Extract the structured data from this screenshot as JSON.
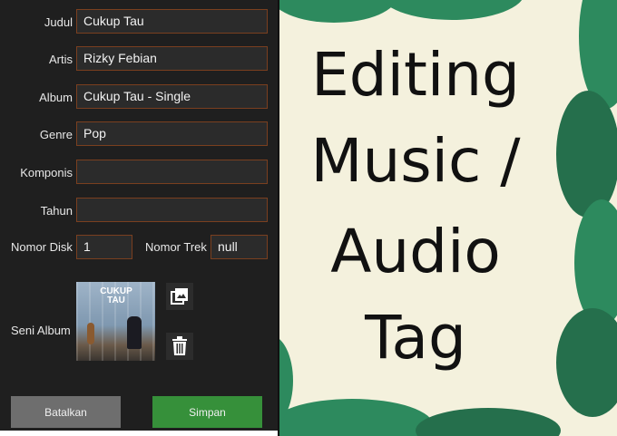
{
  "form": {
    "fields": [
      {
        "label": "Judul",
        "value": "Cukup Tau"
      },
      {
        "label": "Artis",
        "value": "Rizky Febian"
      },
      {
        "label": "Album",
        "value": "Cukup Tau - Single"
      },
      {
        "label": "Genre",
        "value": "Pop"
      },
      {
        "label": "Komponis",
        "value": ""
      },
      {
        "label": "Tahun",
        "value": ""
      }
    ],
    "disk": {
      "label": "Nomor Disk",
      "value": "1"
    },
    "track": {
      "label": "Nomor Trek",
      "value": "null"
    },
    "album_art": {
      "label": "Seni Album",
      "cover_text": "CUKUP TAU"
    },
    "cancel_label": "Batalkan",
    "save_label": "Simpan"
  },
  "banner": {
    "lines": [
      "Editing",
      "Music /",
      "Audio",
      "Tag"
    ]
  },
  "colors": {
    "panel": "#1f1f1f",
    "field_border": "#7a3f1f",
    "save": "#36903a",
    "cancel": "#6e6e6e",
    "leaf": "#2d8a5e",
    "background": "#f4f1dd"
  }
}
